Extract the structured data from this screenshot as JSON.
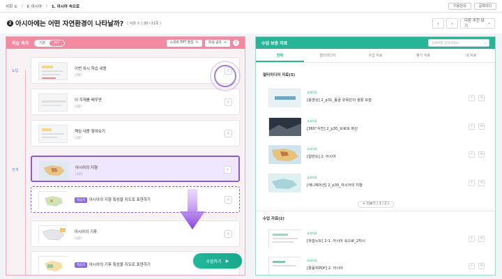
{
  "topbar": {
    "crumbs": [
      "사회 ①",
      "Ⅱ. 아시아",
      "1. 아시아 속으로"
    ],
    "buttons": [
      "이용안내",
      "공략미디"
    ]
  },
  "header": {
    "question_num": "2",
    "title": "아시아에는 어떤 자연환경이 나타날까?",
    "subtitle": "( 사회 ① | 30~31쪽 )",
    "recommend_label": "다른 추천 보기"
  },
  "left": {
    "title": "학습 목차",
    "toggle": [
      "기본",
      "MY"
    ],
    "btn_ppt": "스마트 PPT 편집",
    "btn_share": "학생 공유",
    "stages": [
      "도입",
      "전개"
    ],
    "cards": [
      {
        "title": "이번 차시 학습 내용",
        "duration": "(3분)",
        "badge": ""
      },
      {
        "title": "이 주제를 배우면",
        "duration": "(3분)",
        "badge": ""
      },
      {
        "title": "핵심 내용 찾아보기",
        "duration": "(3분)",
        "badge": ""
      },
      {
        "title": "아시아의 지형",
        "duration": "(3분)",
        "badge": ""
      },
      {
        "title": "아시아의 지형 특성을 지도로 표현하기",
        "duration": "",
        "badge": "학습지"
      },
      {
        "title": "아시아의 기후",
        "duration": "(3분)",
        "badge": ""
      },
      {
        "title": "아시아의 기후 특성을 지도로 표현하기",
        "duration": "",
        "badge": "학습지"
      }
    ],
    "lesson_btn": "수업하기"
  },
  "right": {
    "title": "수업 보충 자료",
    "search_placeholder": "검색어를 입력하세요.",
    "tabs": [
      "전체",
      "멀티미디어",
      "수업 자료",
      "평가 자료",
      "내 자료"
    ],
    "section_media": "멀티미디어 자료(5)",
    "section_class": "수업 자료(2)",
    "resources": [
      {
        "kind": "교과자료",
        "title": "[동영상] 2_p31_몽골 유목민의 생활 모습"
      },
      {
        "kind": "교과자료",
        "title": "[360°사진] 2_p30_브로모 화산"
      },
      {
        "kind": "교과자료",
        "title": "[일반도] 2. 아시아"
      },
      {
        "kind": "교과자료",
        "title": "[애니메이션] 2_p30_아시아의 지형"
      },
      {
        "kind": "교과자료",
        "title": "[학습노트] 2-1. 아시아 속으로_2차시"
      },
      {
        "kind": "교과자료",
        "title": "[활동지PDF] 2. 아시아"
      }
    ],
    "more_label": "+ 더보기 ( 1 / 2 )"
  },
  "colors": {
    "left_accent": "#f38aa2",
    "right_accent": "#28b496",
    "active_purple": "#8a5cd6"
  }
}
